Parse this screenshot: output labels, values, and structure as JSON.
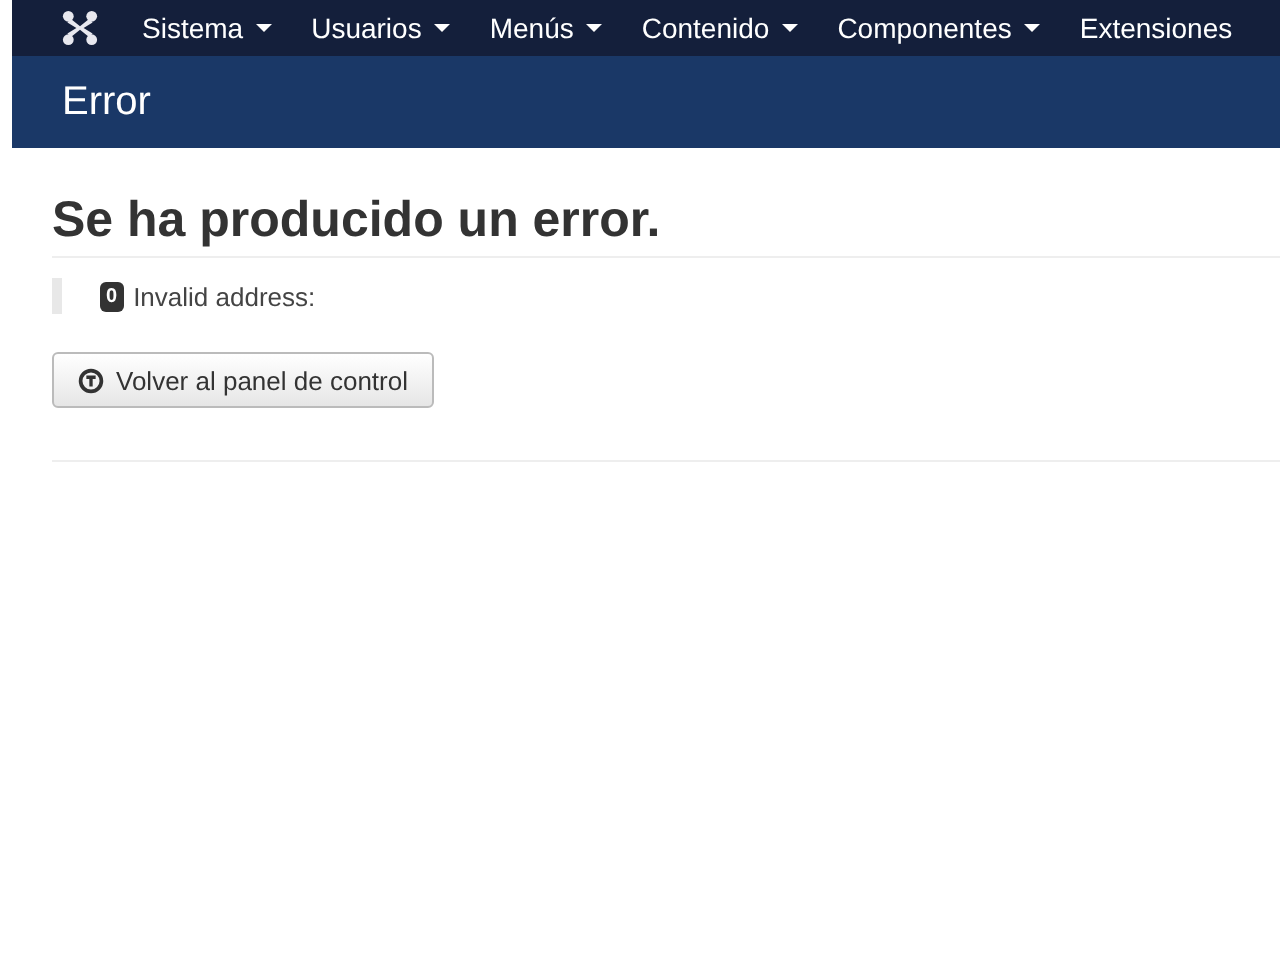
{
  "navbar": {
    "menus": [
      {
        "label": "Sistema",
        "dropdown": true
      },
      {
        "label": "Usuarios",
        "dropdown": true
      },
      {
        "label": "Menús",
        "dropdown": true
      },
      {
        "label": "Contenido",
        "dropdown": true
      },
      {
        "label": "Componentes",
        "dropdown": true
      },
      {
        "label": "Extensiones",
        "dropdown": false
      }
    ]
  },
  "header": {
    "title": "Error"
  },
  "content": {
    "heading": "Se ha producido un error.",
    "error_code": "0",
    "error_message": "Invalid address:",
    "button": "Volver al panel de control"
  }
}
